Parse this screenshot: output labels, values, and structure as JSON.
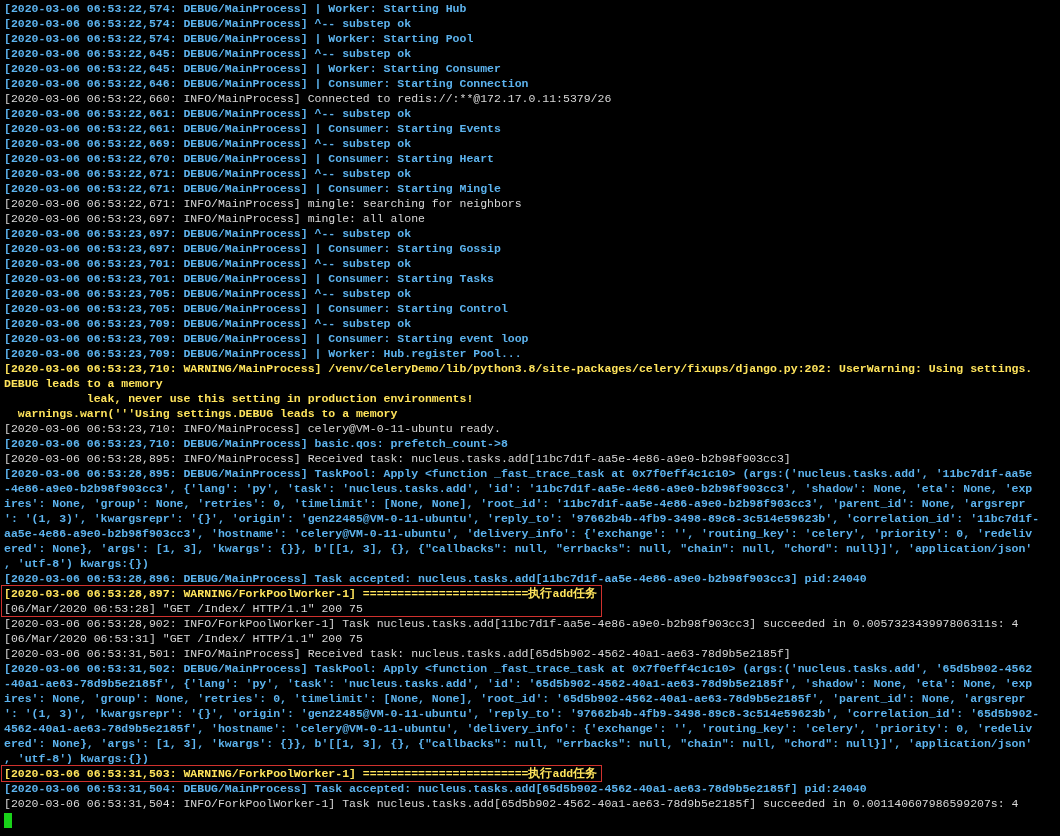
{
  "terminal": {
    "lines": [
      {
        "kind": "debug",
        "boxed": false,
        "text": "[2020-03-06 06:53:22,574: DEBUG/MainProcess] | Worker: Starting Hub"
      },
      {
        "kind": "debug",
        "boxed": false,
        "text": "[2020-03-06 06:53:22,574: DEBUG/MainProcess] ^-- substep ok"
      },
      {
        "kind": "debug",
        "boxed": false,
        "text": "[2020-03-06 06:53:22,574: DEBUG/MainProcess] | Worker: Starting Pool"
      },
      {
        "kind": "debug",
        "boxed": false,
        "text": "[2020-03-06 06:53:22,645: DEBUG/MainProcess] ^-- substep ok"
      },
      {
        "kind": "debug",
        "boxed": false,
        "text": "[2020-03-06 06:53:22,645: DEBUG/MainProcess] | Worker: Starting Consumer"
      },
      {
        "kind": "debug",
        "boxed": false,
        "text": "[2020-03-06 06:53:22,646: DEBUG/MainProcess] | Consumer: Starting Connection"
      },
      {
        "kind": "info",
        "boxed": false,
        "text": "[2020-03-06 06:53:22,660: INFO/MainProcess] Connected to redis://:**@172.17.0.11:5379/26"
      },
      {
        "kind": "debug",
        "boxed": false,
        "text": "[2020-03-06 06:53:22,661: DEBUG/MainProcess] ^-- substep ok"
      },
      {
        "kind": "debug",
        "boxed": false,
        "text": "[2020-03-06 06:53:22,661: DEBUG/MainProcess] | Consumer: Starting Events"
      },
      {
        "kind": "debug",
        "boxed": false,
        "text": "[2020-03-06 06:53:22,669: DEBUG/MainProcess] ^-- substep ok"
      },
      {
        "kind": "debug",
        "boxed": false,
        "text": "[2020-03-06 06:53:22,670: DEBUG/MainProcess] | Consumer: Starting Heart"
      },
      {
        "kind": "debug",
        "boxed": false,
        "text": "[2020-03-06 06:53:22,671: DEBUG/MainProcess] ^-- substep ok"
      },
      {
        "kind": "debug",
        "boxed": false,
        "text": "[2020-03-06 06:53:22,671: DEBUG/MainProcess] | Consumer: Starting Mingle"
      },
      {
        "kind": "info",
        "boxed": false,
        "text": "[2020-03-06 06:53:22,671: INFO/MainProcess] mingle: searching for neighbors"
      },
      {
        "kind": "info",
        "boxed": false,
        "text": "[2020-03-06 06:53:23,697: INFO/MainProcess] mingle: all alone"
      },
      {
        "kind": "debug",
        "boxed": false,
        "text": "[2020-03-06 06:53:23,697: DEBUG/MainProcess] ^-- substep ok"
      },
      {
        "kind": "debug",
        "boxed": false,
        "text": "[2020-03-06 06:53:23,697: DEBUG/MainProcess] | Consumer: Starting Gossip"
      },
      {
        "kind": "debug",
        "boxed": false,
        "text": "[2020-03-06 06:53:23,701: DEBUG/MainProcess] ^-- substep ok"
      },
      {
        "kind": "debug",
        "boxed": false,
        "text": "[2020-03-06 06:53:23,701: DEBUG/MainProcess] | Consumer: Starting Tasks"
      },
      {
        "kind": "debug",
        "boxed": false,
        "text": "[2020-03-06 06:53:23,705: DEBUG/MainProcess] ^-- substep ok"
      },
      {
        "kind": "debug",
        "boxed": false,
        "text": "[2020-03-06 06:53:23,705: DEBUG/MainProcess] | Consumer: Starting Control"
      },
      {
        "kind": "debug",
        "boxed": false,
        "text": "[2020-03-06 06:53:23,709: DEBUG/MainProcess] ^-- substep ok"
      },
      {
        "kind": "debug",
        "boxed": false,
        "text": "[2020-03-06 06:53:23,709: DEBUG/MainProcess] | Consumer: Starting event loop"
      },
      {
        "kind": "debug",
        "boxed": false,
        "text": "[2020-03-06 06:53:23,709: DEBUG/MainProcess] | Worker: Hub.register Pool..."
      },
      {
        "kind": "warning",
        "boxed": false,
        "text": "[2020-03-06 06:53:23,710: WARNING/MainProcess] /venv/CeleryDemo/lib/python3.8/site-packages/celery/fixups/django.py:202: UserWarning: Using settings."
      },
      {
        "kind": "warning",
        "boxed": false,
        "text": "DEBUG leads to a memory"
      },
      {
        "kind": "warning",
        "boxed": false,
        "text": "            leak, never use this setting in production environments!"
      },
      {
        "kind": "warning",
        "boxed": false,
        "text": "  warnings.warn('''Using settings.DEBUG leads to a memory"
      },
      {
        "kind": "info",
        "boxed": false,
        "text": "[2020-03-06 06:53:23,710: INFO/MainProcess] celery@VM-0-11-ubuntu ready."
      },
      {
        "kind": "debug",
        "boxed": false,
        "text": "[2020-03-06 06:53:23,710: DEBUG/MainProcess] basic.qos: prefetch_count->8"
      },
      {
        "kind": "info",
        "boxed": false,
        "text": "[2020-03-06 06:53:28,895: INFO/MainProcess] Received task: nucleus.tasks.add[11bc7d1f-aa5e-4e86-a9e0-b2b98f903cc3]"
      },
      {
        "kind": "debug",
        "boxed": false,
        "text": "[2020-03-06 06:53:28,895: DEBUG/MainProcess] TaskPool: Apply <function _fast_trace_task at 0x7f0eff4c1c10> (args:('nucleus.tasks.add', '11bc7d1f-aa5e"
      },
      {
        "kind": "debug",
        "boxed": false,
        "text": "-4e86-a9e0-b2b98f903cc3', {'lang': 'py', 'task': 'nucleus.tasks.add', 'id': '11bc7d1f-aa5e-4e86-a9e0-b2b98f903cc3', 'shadow': None, 'eta': None, 'exp"
      },
      {
        "kind": "debug",
        "boxed": false,
        "text": "ires': None, 'group': None, 'retries': 0, 'timelimit': [None, None], 'root_id': '11bc7d1f-aa5e-4e86-a9e0-b2b98f903cc3', 'parent_id': None, 'argsrepr"
      },
      {
        "kind": "debug",
        "boxed": false,
        "text": "': '(1, 3)', 'kwargsrepr': '{}', 'origin': 'gen22485@VM-0-11-ubuntu', 'reply_to': '97662b4b-4fb9-3498-89c8-3c514e59623b', 'correlation_id': '11bc7d1f-"
      },
      {
        "kind": "debug",
        "boxed": false,
        "text": "aa5e-4e86-a9e0-b2b98f903cc3', 'hostname': 'celery@VM-0-11-ubuntu', 'delivery_info': {'exchange': '', 'routing_key': 'celery', 'priority': 0, 'redeliv"
      },
      {
        "kind": "debug",
        "boxed": false,
        "text": "ered': None}, 'args': [1, 3], 'kwargs': {}}, b'[[1, 3], {}, {\"callbacks\": null, \"errbacks\": null, \"chain\": null, \"chord\": null}]', 'application/json'"
      },
      {
        "kind": "debug",
        "boxed": false,
        "text": ", 'utf-8') kwargs:{})"
      },
      {
        "kind": "debug",
        "boxed": false,
        "text": "[2020-03-06 06:53:28,896: DEBUG/MainProcess] Task accepted: nucleus.tasks.add[11bc7d1f-aa5e-4e86-a9e0-b2b98f903cc3] pid:24040"
      },
      {
        "kind": "warning",
        "boxed": true,
        "text": "[2020-03-06 06:53:28,897: WARNING/ForkPoolWorker-1] ========================执行add任务"
      },
      {
        "kind": "info",
        "boxed": true,
        "text": "[06/Mar/2020 06:53:28] \"GET /Index/ HTTP/1.1\" 200 75"
      },
      {
        "kind": "info",
        "boxed": false,
        "text": "[2020-03-06 06:53:28,902: INFO/ForkPoolWorker-1] Task nucleus.tasks.add[11bc7d1f-aa5e-4e86-a9e0-b2b98f903cc3] succeeded in 0.005732343997806311s: 4"
      },
      {
        "kind": "info",
        "boxed": false,
        "text": "[06/Mar/2020 06:53:31] \"GET /Index/ HTTP/1.1\" 200 75"
      },
      {
        "kind": "info",
        "boxed": false,
        "text": "[2020-03-06 06:53:31,501: INFO/MainProcess] Received task: nucleus.tasks.add[65d5b902-4562-40a1-ae63-78d9b5e2185f]"
      },
      {
        "kind": "debug",
        "boxed": false,
        "text": "[2020-03-06 06:53:31,502: DEBUG/MainProcess] TaskPool: Apply <function _fast_trace_task at 0x7f0eff4c1c10> (args:('nucleus.tasks.add', '65d5b902-4562"
      },
      {
        "kind": "debug",
        "boxed": false,
        "text": "-40a1-ae63-78d9b5e2185f', {'lang': 'py', 'task': 'nucleus.tasks.add', 'id': '65d5b902-4562-40a1-ae63-78d9b5e2185f', 'shadow': None, 'eta': None, 'exp"
      },
      {
        "kind": "debug",
        "boxed": false,
        "text": "ires': None, 'group': None, 'retries': 0, 'timelimit': [None, None], 'root_id': '65d5b902-4562-40a1-ae63-78d9b5e2185f', 'parent_id': None, 'argsrepr"
      },
      {
        "kind": "debug",
        "boxed": false,
        "text": "': '(1, 3)', 'kwargsrepr': '{}', 'origin': 'gen22485@VM-0-11-ubuntu', 'reply_to': '97662b4b-4fb9-3498-89c8-3c514e59623b', 'correlation_id': '65d5b902-"
      },
      {
        "kind": "debug",
        "boxed": false,
        "text": "4562-40a1-ae63-78d9b5e2185f', 'hostname': 'celery@VM-0-11-ubuntu', 'delivery_info': {'exchange': '', 'routing_key': 'celery', 'priority': 0, 'redeliv"
      },
      {
        "kind": "debug",
        "boxed": false,
        "text": "ered': None}, 'args': [1, 3], 'kwargs': {}}, b'[[1, 3], {}, {\"callbacks\": null, \"errbacks\": null, \"chain\": null, \"chord\": null}]', 'application/json'"
      },
      {
        "kind": "debug",
        "boxed": false,
        "text": ", 'utf-8') kwargs:{})"
      },
      {
        "kind": "warning",
        "boxed": true,
        "text": "[2020-03-06 06:53:31,503: WARNING/ForkPoolWorker-1] ========================执行add任务"
      },
      {
        "kind": "debug",
        "boxed": false,
        "text": "[2020-03-06 06:53:31,504: DEBUG/MainProcess] Task accepted: nucleus.tasks.add[65d5b902-4562-40a1-ae63-78d9b5e2185f] pid:24040"
      },
      {
        "kind": "info",
        "boxed": false,
        "text": "[2020-03-06 06:53:31,504: INFO/ForkPoolWorker-1] Task nucleus.tasks.add[65d5b902-4562-40a1-ae63-78d9b5e2185f] succeeded in 0.001140607986599207s: 4"
      }
    ]
  }
}
